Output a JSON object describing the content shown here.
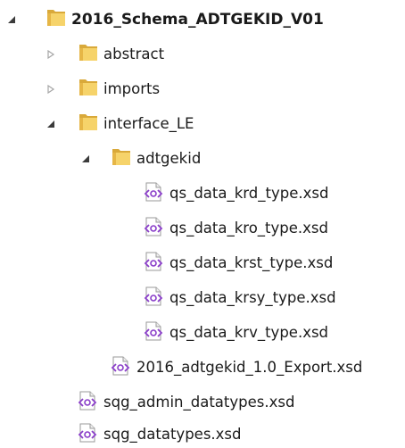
{
  "tree": {
    "root": {
      "label": "2016_Schema_ADTGEKID_V01",
      "icon": "folder-icon",
      "expanded": true
    },
    "items": [
      {
        "label": "abstract",
        "icon": "folder-icon",
        "expanded": false
      },
      {
        "label": "imports",
        "icon": "folder-icon",
        "expanded": false
      },
      {
        "label": "interface_LE",
        "icon": "folder-icon",
        "expanded": true
      },
      {
        "label": "adtgekid",
        "icon": "folder-icon",
        "expanded": true
      },
      {
        "label": "qs_data_krd_type.xsd",
        "icon": "xsd-file-icon"
      },
      {
        "label": "qs_data_kro_type.xsd",
        "icon": "xsd-file-icon"
      },
      {
        "label": "qs_data_krst_type.xsd",
        "icon": "xsd-file-icon"
      },
      {
        "label": "qs_data_krsy_type.xsd",
        "icon": "xsd-file-icon"
      },
      {
        "label": "qs_data_krv_type.xsd",
        "icon": "xsd-file-icon"
      },
      {
        "label": "2016_adtgekid_1.0_Export.xsd",
        "icon": "xsd-file-icon"
      },
      {
        "label": "sqg_admin_datatypes.xsd",
        "icon": "xsd-file-icon"
      },
      {
        "label": "sqg_datatypes.xsd",
        "icon": "xsd-file-icon"
      }
    ]
  },
  "colors": {
    "folder_front": "#f6d36a",
    "folder_back": "#d9a93a",
    "xsd_accent": "#8a3ec9",
    "twisty_expanded": "#3b3b3b",
    "twisty_collapsed": "#a6a6a6"
  }
}
